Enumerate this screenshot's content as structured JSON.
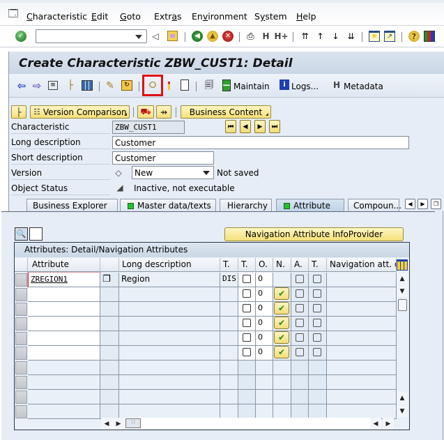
{
  "menubar": {
    "items": [
      {
        "label": "Characteristic",
        "mnemonic": "C"
      },
      {
        "label": "Edit",
        "mnemonic": "E"
      },
      {
        "label": "Goto",
        "mnemonic": "G"
      },
      {
        "label": "Extras",
        "mnemonic": "a"
      },
      {
        "label": "Environment",
        "mnemonic": "v"
      },
      {
        "label": "System",
        "mnemonic": "y"
      },
      {
        "label": "Help",
        "mnemonic": "H"
      }
    ]
  },
  "system_toolbar": {
    "command_field": {
      "value": "",
      "placeholder": ""
    },
    "icons": [
      "enter-icon",
      "back-collapse-icon",
      "save-icon",
      "back-icon",
      "exit-icon",
      "cancel-icon",
      "print-icon",
      "find-icon",
      "find-next-icon",
      "first-page-icon",
      "previous-page-icon",
      "next-page-icon",
      "last-page-icon",
      "new-session-icon",
      "shortcut-icon",
      "help-icon",
      "layout-icon"
    ]
  },
  "title": "Create Characteristic ZBW_CUST1: Detail",
  "app_toolbar": {
    "maintain_label": "Maintain",
    "logs_label": "Logs...",
    "metadata_label": "Metadata",
    "highlighted_icon": "check-icon"
  },
  "subtoolbar": {
    "version_comparison_label": "Version Comparison",
    "business_content_label": "Business Content"
  },
  "form": {
    "characteristic": {
      "label": "Characteristic",
      "value": "ZBW_CUST1"
    },
    "long_description": {
      "label": "Long description",
      "value": "Customer"
    },
    "short_description": {
      "label": "Short description",
      "value": "Customer"
    },
    "version": {
      "label": "Version",
      "value": "New",
      "status": "Not saved"
    },
    "object_status": {
      "label": "Object Status",
      "value": "Inactive, not executable"
    }
  },
  "tabs": [
    {
      "label": "Business Explorer",
      "status": null,
      "active": false
    },
    {
      "label": "Master data/texts",
      "status": "green",
      "active": false
    },
    {
      "label": "Hierarchy",
      "status": null,
      "active": false
    },
    {
      "label": "Attribute",
      "status": "green",
      "active": true
    },
    {
      "label": "Compoun...",
      "status": null,
      "active": false
    }
  ],
  "attribute_tab": {
    "nav_attr_infoprovider_label": "Navigation Attribute InfoProvider",
    "grid": {
      "title": "Attributes: Detail/Navigation Attributes",
      "columns": [
        "Attribute",
        "",
        "Long description",
        "T.",
        "T.",
        "O.",
        "N.",
        "A.",
        "T.",
        "Navigation att. d"
      ],
      "rows": [
        {
          "attribute": "ZREGION1",
          "long_description": "Region",
          "type": "DIS",
          "t_checked": false,
          "order": "0",
          "nav_button": false,
          "a_checked": false,
          "t2_checked": false,
          "nav_desc": ""
        },
        {
          "attribute": "",
          "long_description": "",
          "type": "",
          "t_checked": false,
          "order": "0",
          "nav_button": true,
          "a_checked": false,
          "t2_checked": false,
          "nav_desc": ""
        },
        {
          "attribute": "",
          "long_description": "",
          "type": "",
          "t_checked": false,
          "order": "0",
          "nav_button": true,
          "a_checked": false,
          "t2_checked": false,
          "nav_desc": ""
        },
        {
          "attribute": "",
          "long_description": "",
          "type": "",
          "t_checked": false,
          "order": "0",
          "nav_button": true,
          "a_checked": false,
          "t2_checked": false,
          "nav_desc": ""
        },
        {
          "attribute": "",
          "long_description": "",
          "type": "",
          "t_checked": false,
          "order": "0",
          "nav_button": true,
          "a_checked": false,
          "t2_checked": false,
          "nav_desc": ""
        },
        {
          "attribute": "",
          "long_description": "",
          "type": "",
          "t_checked": false,
          "order": "0",
          "nav_button": true,
          "a_checked": false,
          "t2_checked": false,
          "nav_desc": ""
        },
        {
          "attribute": "",
          "long_description": "",
          "type": "",
          "t_checked": null,
          "order": "",
          "nav_button": false,
          "a_checked": null,
          "t2_checked": null,
          "nav_desc": ""
        },
        {
          "attribute": "",
          "long_description": "",
          "type": "",
          "t_checked": null,
          "order": "",
          "nav_button": false,
          "a_checked": null,
          "t2_checked": null,
          "nav_desc": ""
        },
        {
          "attribute": "",
          "long_description": "",
          "type": "",
          "t_checked": null,
          "order": "",
          "nav_button": false,
          "a_checked": null,
          "t2_checked": null,
          "nav_desc": ""
        },
        {
          "attribute": "",
          "long_description": "",
          "type": "",
          "t_checked": null,
          "order": "",
          "nav_button": false,
          "a_checked": null,
          "t2_checked": null,
          "nav_desc": ""
        }
      ]
    }
  },
  "colors": {
    "highlight_box": "#e01010",
    "status_green": "#22c22e",
    "sap_yellow_button": "#f5e07a",
    "frame_background": "#e6edf6"
  }
}
